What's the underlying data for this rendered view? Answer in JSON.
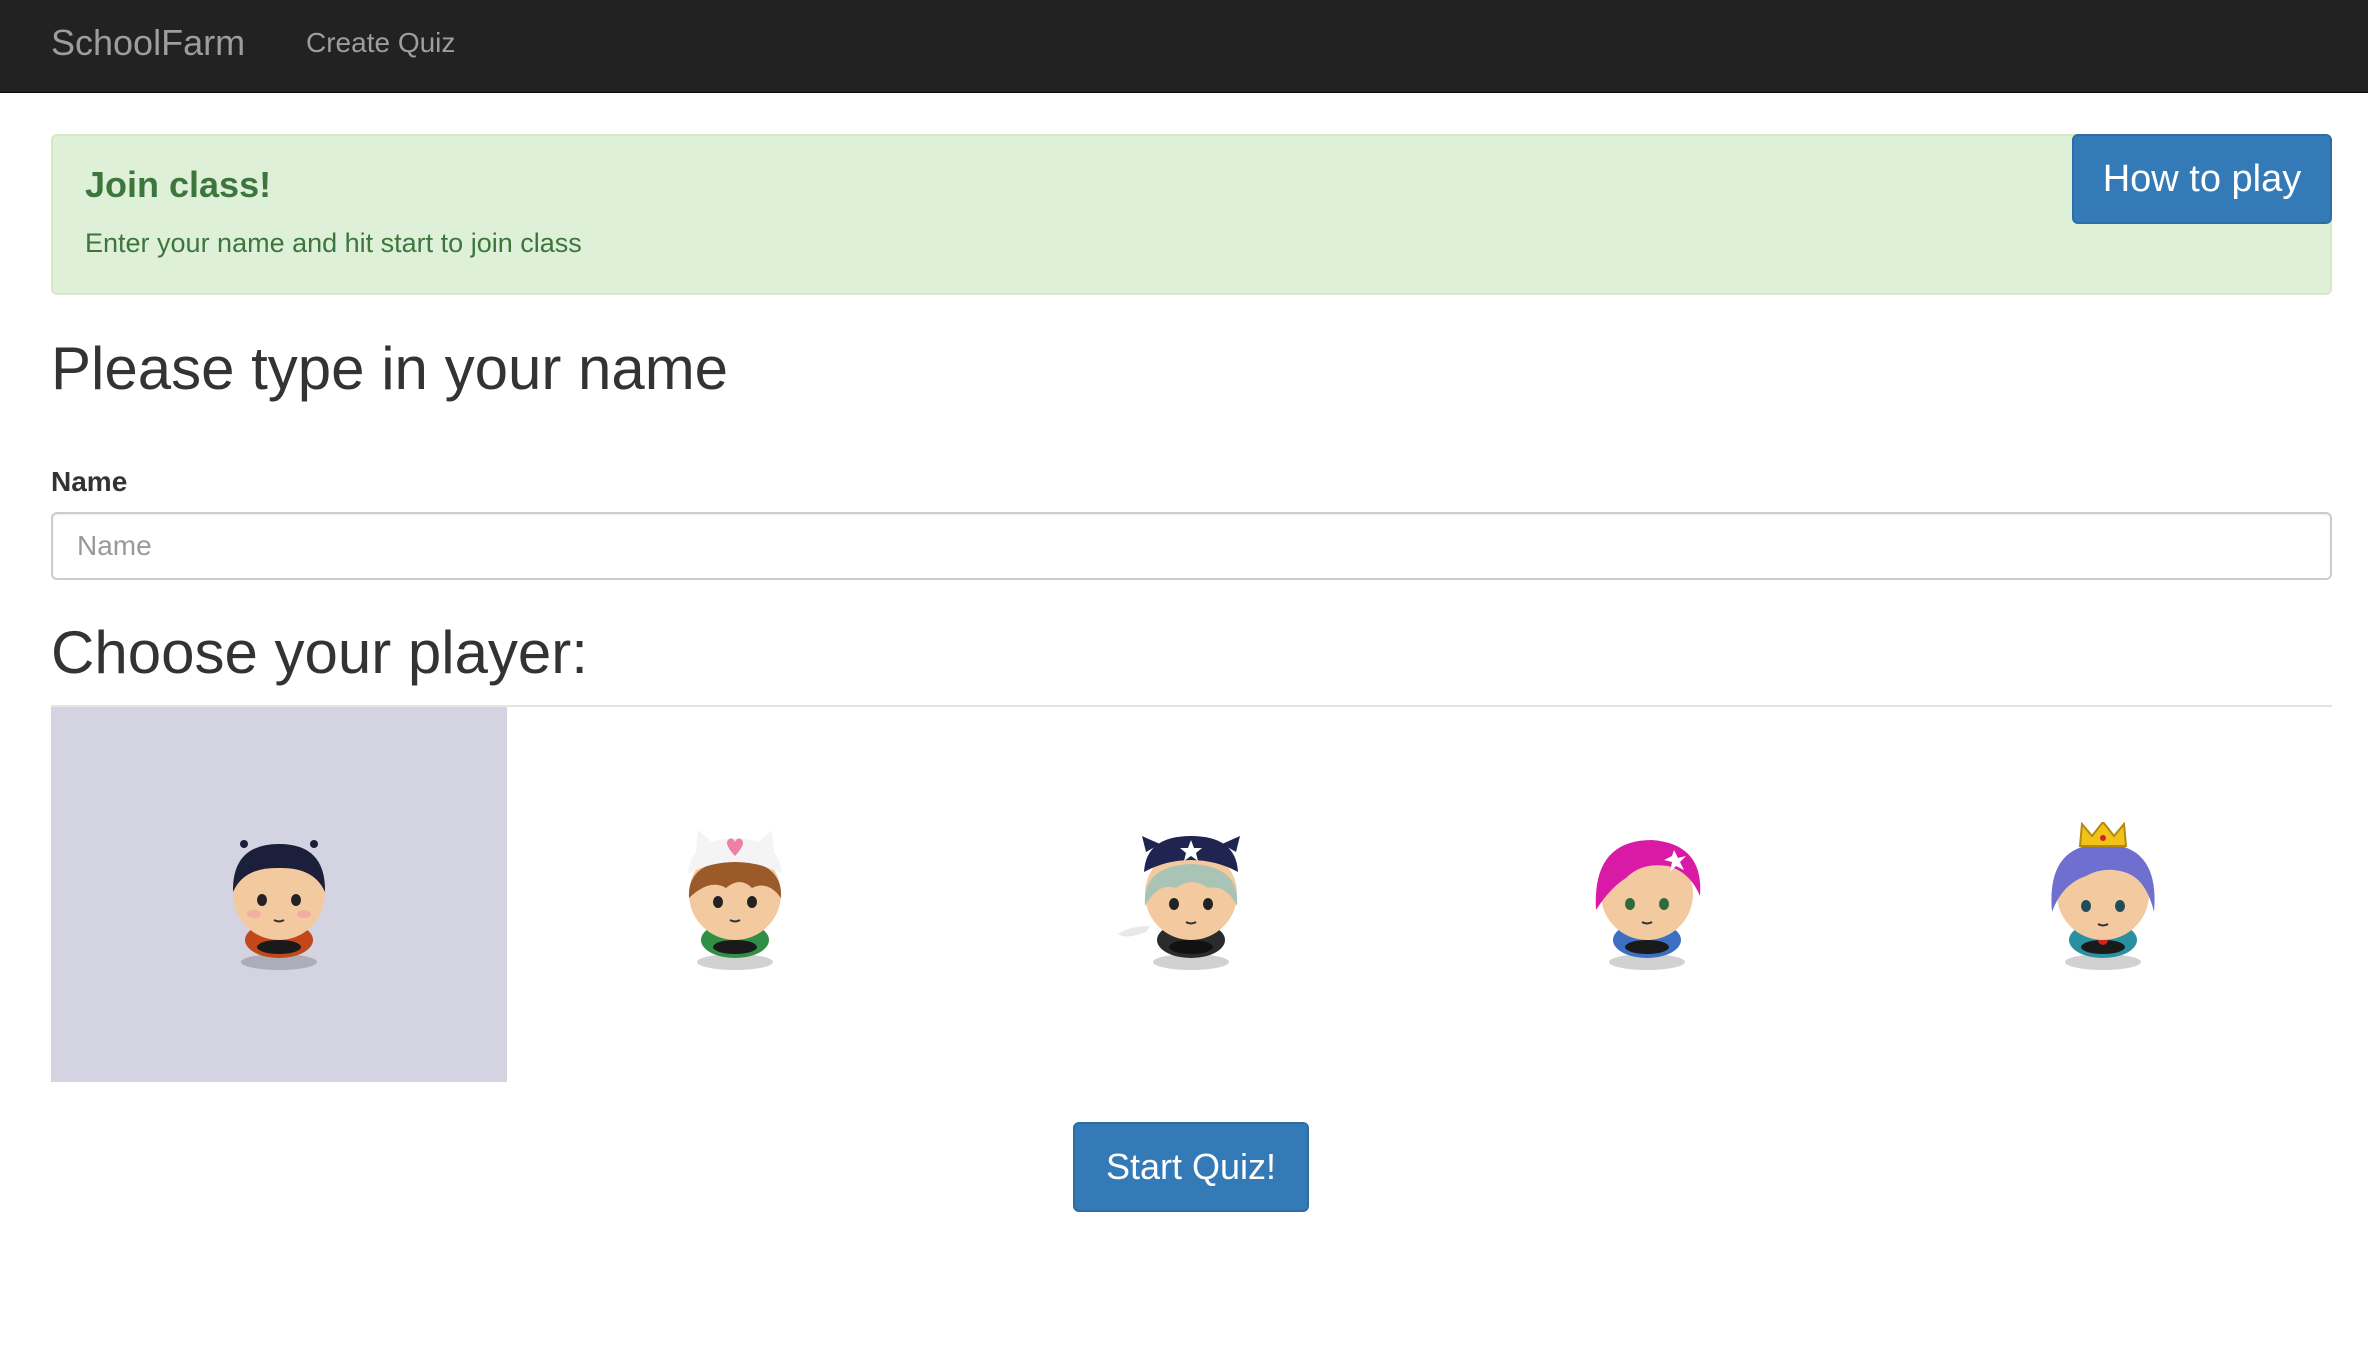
{
  "navbar": {
    "brand": "SchoolFarm",
    "links": [
      {
        "label": "Create Quiz"
      }
    ]
  },
  "alert": {
    "title": "Join class!",
    "text": "Enter your name and hit start to join class",
    "how_to_play_label": "How to play"
  },
  "form": {
    "heading": "Please type in your name",
    "name_label": "Name",
    "name_value": "",
    "name_placeholder": "Name"
  },
  "players": {
    "heading": "Choose your player:",
    "selected_index": 0,
    "items": [
      {
        "icon": "boy-black-hair-avatar-icon",
        "hair": "#1b1f3a",
        "shirt": "#c2471b"
      },
      {
        "icon": "boy-cat-hat-avatar-icon",
        "hair": "#9b5a2a",
        "shirt": "#2f8f45"
      },
      {
        "icon": "pirate-hat-avatar-icon",
        "hair": "#a9c4b4",
        "shirt": "#2b2b2b"
      },
      {
        "icon": "girl-pink-hair-avatar-icon",
        "hair": "#d91aa6",
        "shirt": "#3c6fc2"
      },
      {
        "icon": "princess-crown-avatar-icon",
        "hair": "#6f6fd0",
        "shirt": "#2a8fa0"
      }
    ]
  },
  "start_button_label": "Start Quiz!",
  "colors": {
    "navbar": "#222222",
    "alert_bg": "#dff0d8",
    "alert_text": "#3c763d",
    "primary": "#337ab7",
    "selected_player_bg": "#d3d3e1"
  }
}
